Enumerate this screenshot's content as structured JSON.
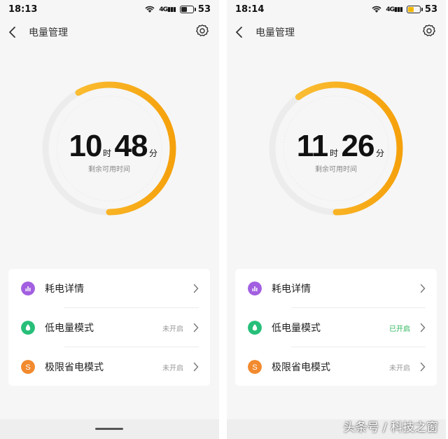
{
  "screens": [
    {
      "time": "18:13",
      "battery_level": "53",
      "battery_saver_on": false,
      "title": "电量管理",
      "remaining_fraction": 0.58,
      "hours": "10",
      "hours_unit": "时",
      "minutes": "48",
      "minutes_unit": "分",
      "remaining_label": "剩余可用时间",
      "menu": [
        {
          "label": "耗电详情",
          "status": "",
          "icon": "bar-chart-icon",
          "color": "#a25fe0"
        },
        {
          "label": "低电量模式",
          "status": "未开启",
          "icon": "leaf-icon",
          "color": "#27bf7a"
        },
        {
          "label": "极限省电模式",
          "status": "未开启",
          "icon": "s-icon",
          "color": "#f28a2e",
          "letter": "S"
        }
      ]
    },
    {
      "time": "18:14",
      "battery_level": "53",
      "battery_saver_on": true,
      "title": "电量管理",
      "remaining_fraction": 0.6,
      "hours": "11",
      "hours_unit": "时",
      "minutes": "26",
      "minutes_unit": "分",
      "remaining_label": "剩余可用时间",
      "menu": [
        {
          "label": "耗电详情",
          "status": "",
          "icon": "bar-chart-icon",
          "color": "#a25fe0"
        },
        {
          "label": "低电量模式",
          "status": "已开启",
          "icon": "leaf-icon",
          "color": "#27bf7a",
          "status_on": true
        },
        {
          "label": "极限省电模式",
          "status": "未开启",
          "icon": "s-icon",
          "color": "#f28a2e",
          "letter": "S"
        }
      ]
    }
  ],
  "watermark": "头条号 / 科技之窗",
  "colors": {
    "ring_start": "#fcc53c",
    "ring_end": "#f5a10c",
    "ring_track": "#ececec",
    "on_status": "#2db55d"
  }
}
